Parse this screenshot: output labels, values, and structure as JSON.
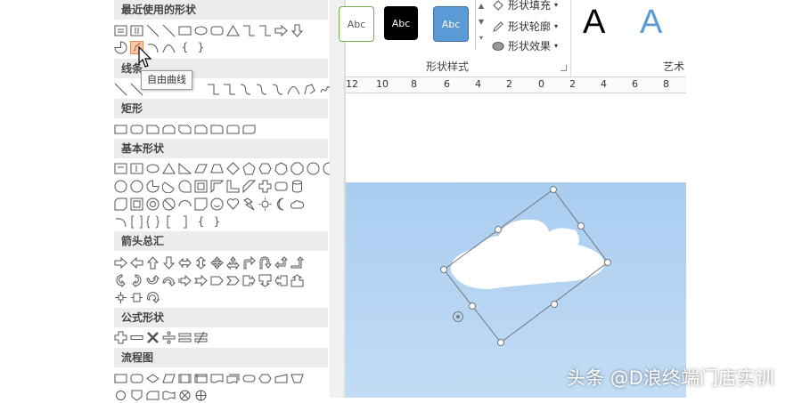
{
  "gallery": {
    "sections": [
      {
        "title": "最近使用的形状"
      },
      {
        "title": "线条"
      },
      {
        "title": "矩形"
      },
      {
        "title": "基本形状"
      },
      {
        "title": "箭头总汇"
      },
      {
        "title": "公式形状"
      },
      {
        "title": "流程图"
      }
    ],
    "tooltip": "自由曲线",
    "brace_glyphs": [
      "{",
      "}"
    ]
  },
  "ribbon": {
    "style_samples": [
      "Abc",
      "Abc",
      "Abc"
    ],
    "shape_fill": "形状填充",
    "shape_outline": "形状轮廓",
    "shape_effects": "形状效果",
    "group_label": "形状样式",
    "art_label": "艺术",
    "art_letters": [
      "A",
      "A"
    ]
  },
  "ruler": {
    "ticks": [
      "12",
      "10",
      "8",
      "6",
      "4",
      "2",
      "0",
      "2",
      "4",
      "6",
      "8"
    ]
  },
  "watermark": "头条 @D浪终端门店实训",
  "colors": {
    "accent_blue": "#5b9bd5",
    "slide_bg": "#b3d3f2",
    "section_bg": "#ececec"
  }
}
